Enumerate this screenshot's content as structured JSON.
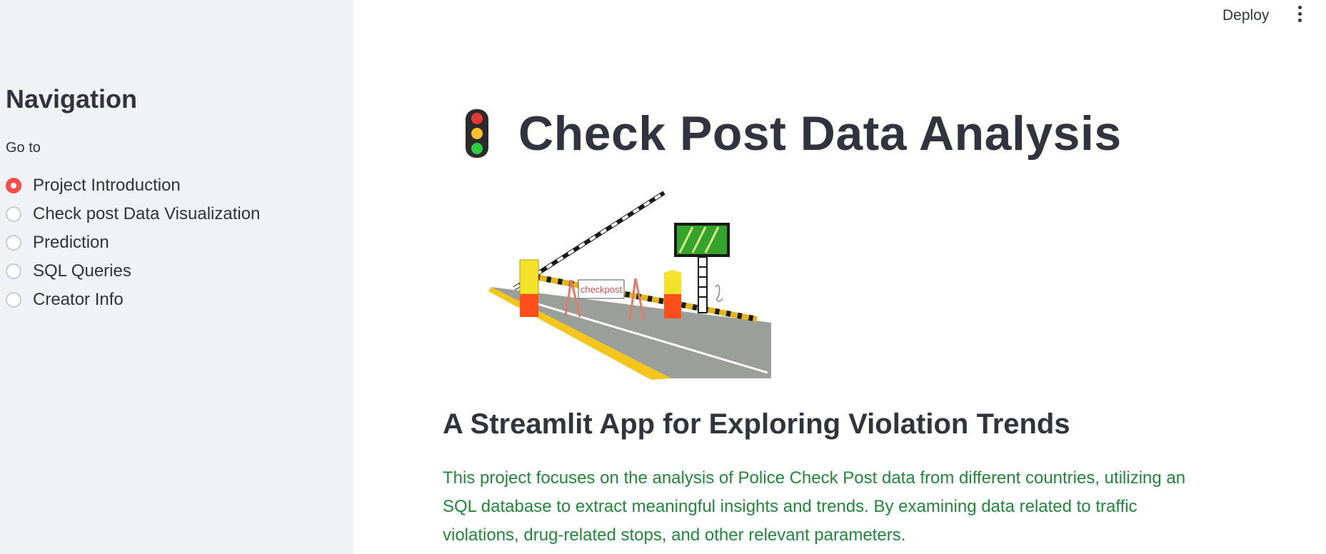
{
  "sidebar": {
    "heading": "Navigation",
    "radio_label": "Go to",
    "options": [
      {
        "label": "Project Introduction",
        "selected": true
      },
      {
        "label": "Check post Data Visualization",
        "selected": false
      },
      {
        "label": "Prediction",
        "selected": false
      },
      {
        "label": "SQL Queries",
        "selected": false
      },
      {
        "label": "Creator Info",
        "selected": false
      }
    ]
  },
  "header": {
    "deploy_label": "Deploy",
    "menu_icon": "kebab-menu-icon"
  },
  "main": {
    "title_icon": "traffic-light-icon",
    "title": "Check Post Data Analysis",
    "image": {
      "sign_text": "checkpost"
    },
    "subtitle": "A Streamlit App for Exploring Violation Trends",
    "description": "This project focuses on the analysis of Police Check Post data from different countries, utilizing an SQL database to extract meaningful insights and trends. By examining data related to traffic violations, drug-related stops, and other relevant parameters."
  },
  "colors": {
    "accent": "#ff4b4b",
    "sidebar_bg": "#f0f2f6",
    "text": "#31333f",
    "description_text": "#21883a"
  }
}
